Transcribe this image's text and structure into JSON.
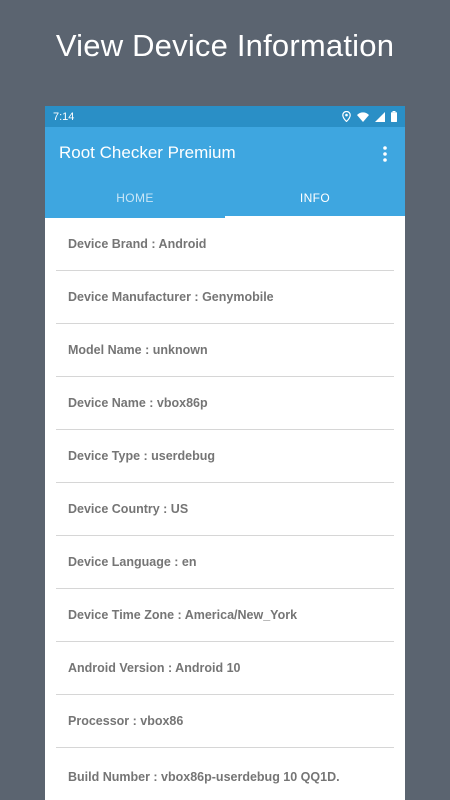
{
  "promo": {
    "title": "View Device Information"
  },
  "status_bar": {
    "time": "7:14",
    "icons": [
      "location-icon",
      "wifi-icon",
      "signal-icon",
      "battery-icon"
    ]
  },
  "app_bar": {
    "title": "Root Checker Premium",
    "overflow_icon": "more-vert-icon",
    "color": "#3ea6e0"
  },
  "tabs": [
    {
      "label": "HOME",
      "active": false
    },
    {
      "label": "INFO",
      "active": true
    }
  ],
  "info_items": [
    "Device Brand : Android",
    "Device Manufacturer : Genymobile",
    "Model Name : unknown",
    "Device Name : vbox86p",
    "Device Type : userdebug",
    "Device Country : US",
    "Device Language : en",
    "Device Time Zone : America/New_York",
    "Android Version : Android 10",
    "Processor : vbox86",
    "Build Number : vbox86p-userdebug 10 QQ1D."
  ]
}
